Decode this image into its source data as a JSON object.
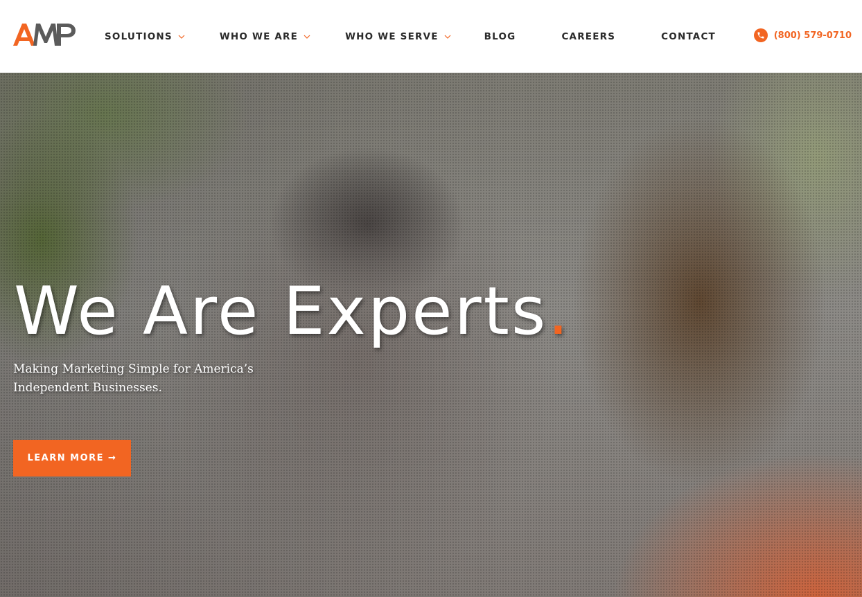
{
  "brand": {
    "logo_text": "AMP",
    "accent_color": "#f26522",
    "logo_dark_color": "#5b5b5b"
  },
  "nav": {
    "items": [
      {
        "label": "SOLUTIONS",
        "has_dropdown": true
      },
      {
        "label": "WHO WE ARE",
        "has_dropdown": true
      },
      {
        "label": "WHO WE SERVE",
        "has_dropdown": true
      },
      {
        "label": "BLOG",
        "has_dropdown": false
      },
      {
        "label": "CAREERS",
        "has_dropdown": false
      },
      {
        "label": "CONTACT",
        "has_dropdown": false
      }
    ]
  },
  "header": {
    "phone": "(800) 579-0710",
    "phone_icon": "phone-icon"
  },
  "hero": {
    "title": "We Are Experts",
    "title_dot": ".",
    "subtitle": "Making Marketing Simple for America’s Independent Businesses.",
    "cta_label": "LEARN MORE →"
  }
}
